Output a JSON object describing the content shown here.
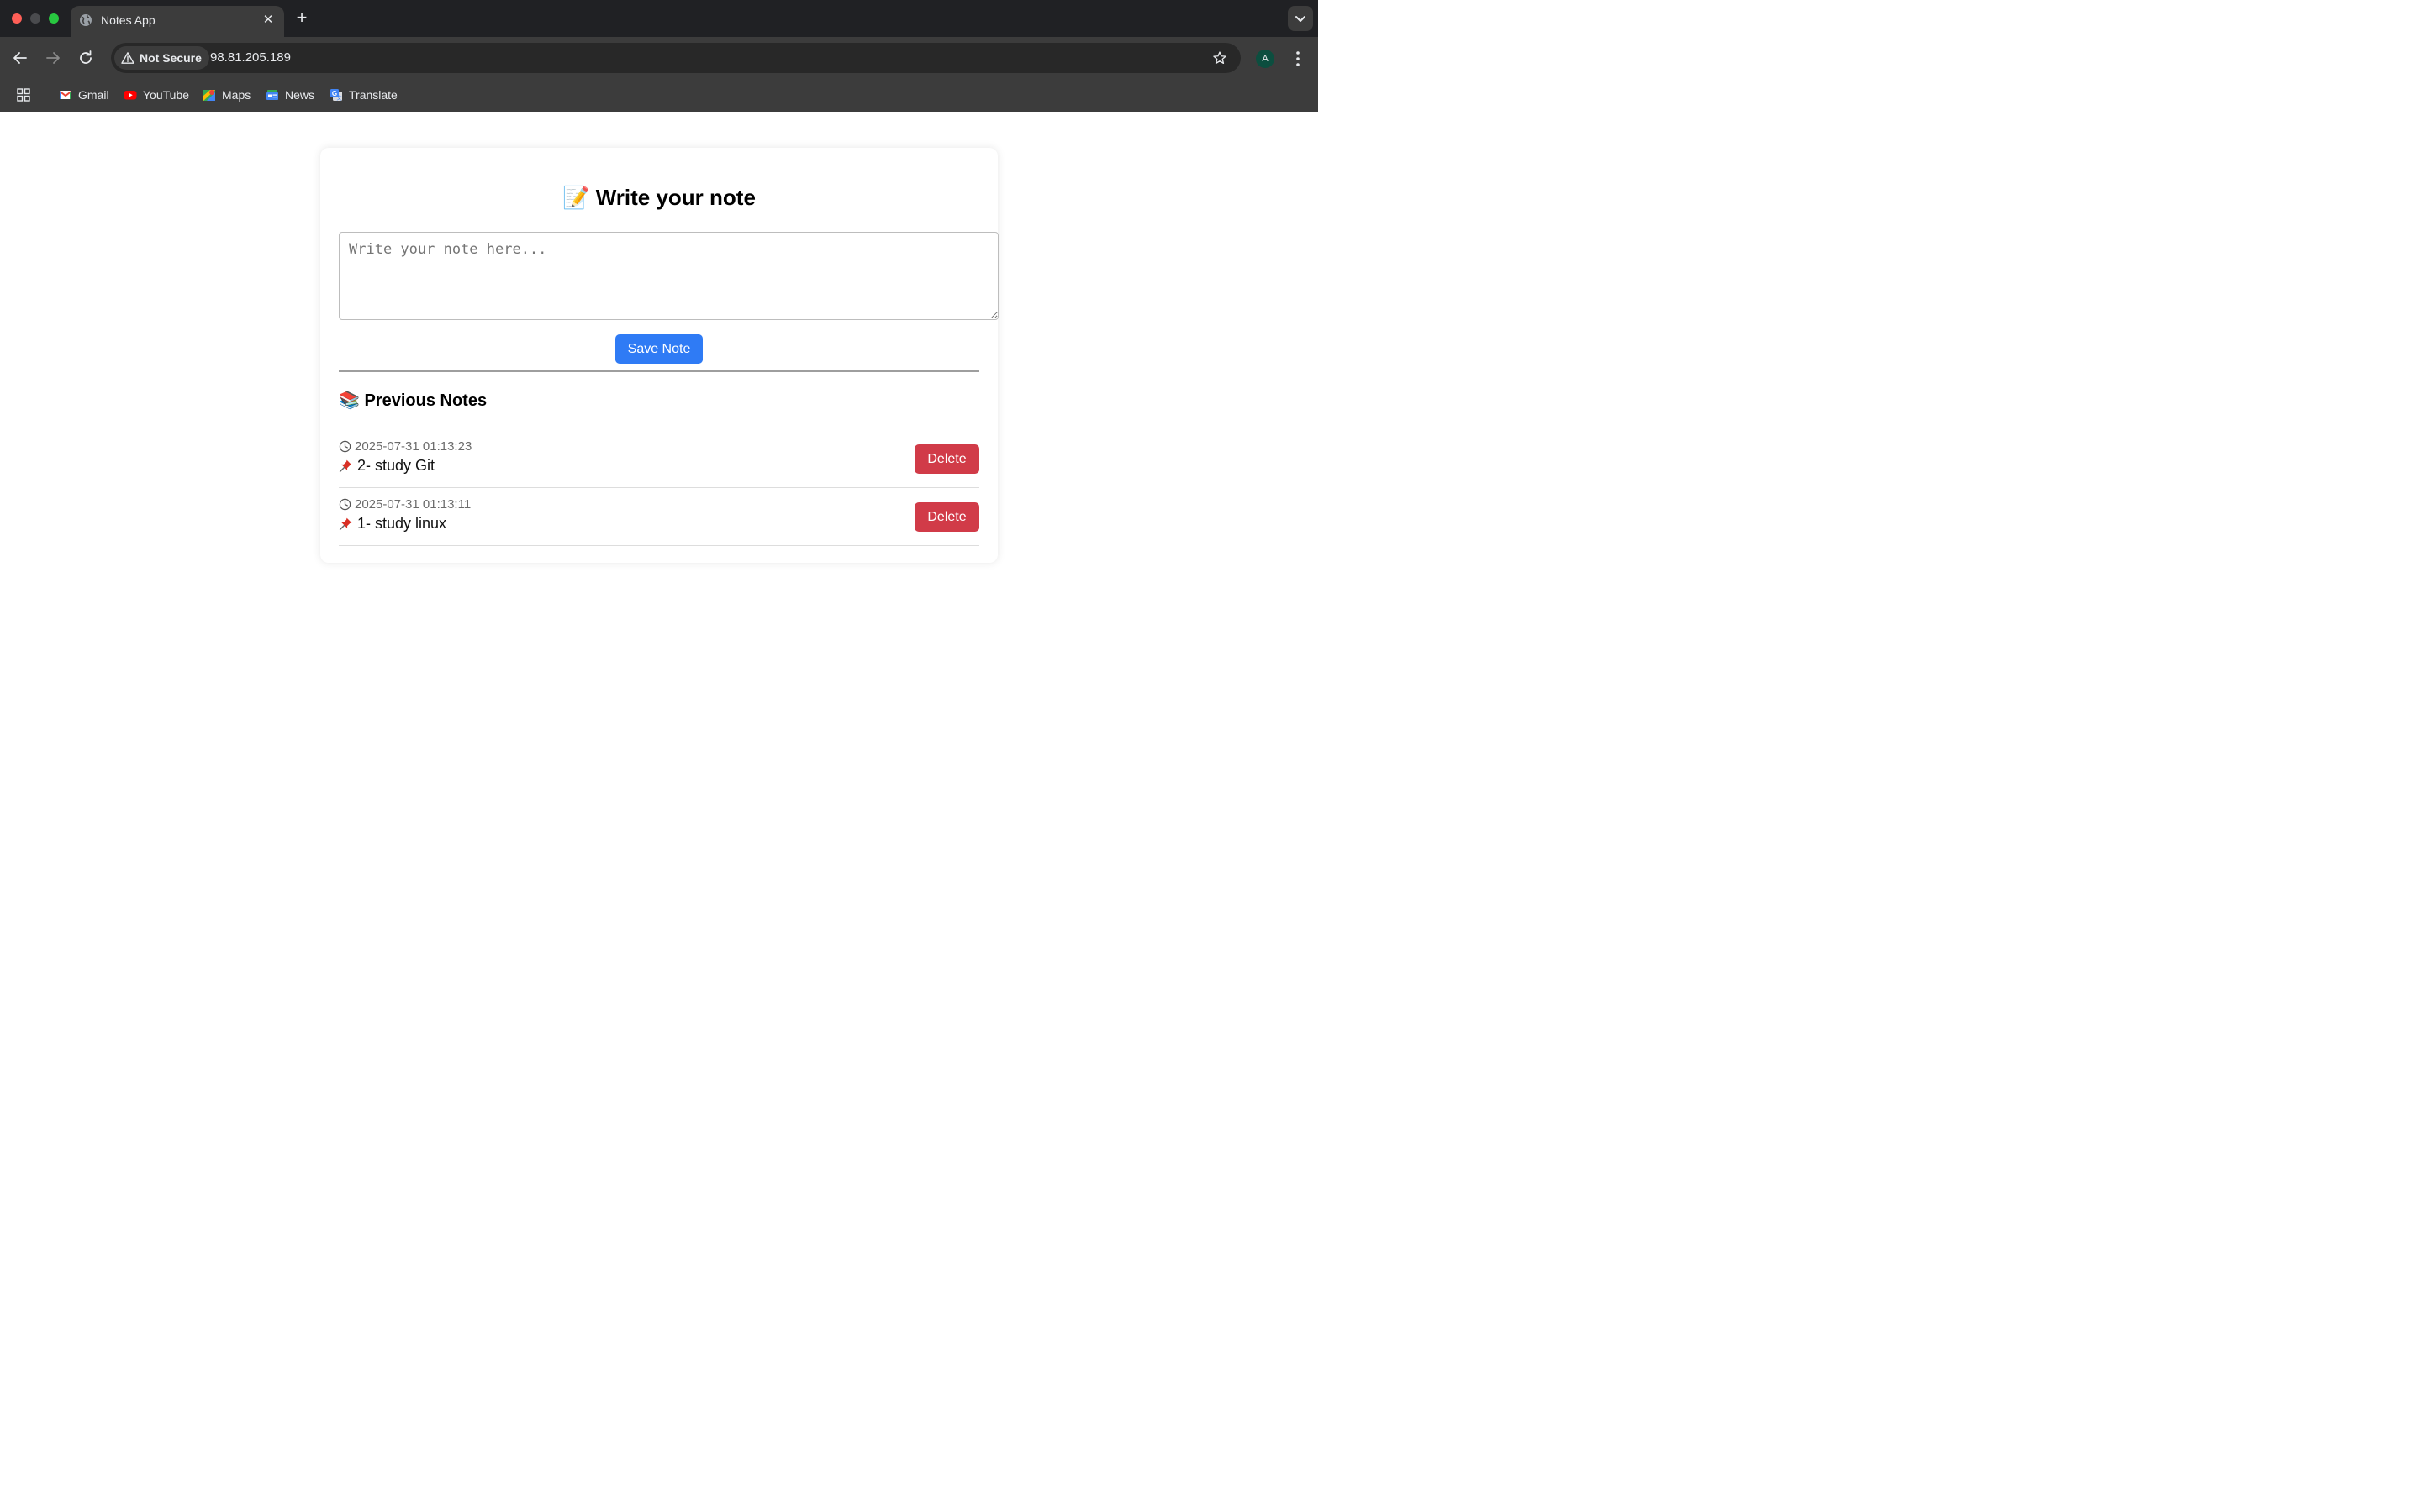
{
  "browser": {
    "tab_title": "Notes App",
    "tab_close": "✕",
    "new_tab": "+",
    "security_label": "Not Secure",
    "url": "98.81.205.189",
    "profile_initial": "A",
    "bookmarks": [
      {
        "label": "Gmail",
        "icon": "gmail-icon"
      },
      {
        "label": "YouTube",
        "icon": "youtube-icon"
      },
      {
        "label": "Maps",
        "icon": "maps-icon"
      },
      {
        "label": "News",
        "icon": "news-icon"
      },
      {
        "label": "Translate",
        "icon": "translate-icon"
      }
    ]
  },
  "page": {
    "title_emoji": "📝",
    "title": "Write your note",
    "input_placeholder": "Write your note here...",
    "save_label": "Save Note",
    "previous_emoji": "📚",
    "previous_title": "Previous Notes",
    "notes": [
      {
        "timestamp": "2025-07-31 01:13:23",
        "text": "2- study Git",
        "delete_label": "Delete"
      },
      {
        "timestamp": "2025-07-31 01:13:11",
        "text": "1- study linux",
        "delete_label": "Delete"
      }
    ]
  },
  "colors": {
    "accent_blue": "#2f7bf5",
    "delete_red": "#d13b48",
    "chrome_dark": "#202124",
    "chrome_toolbar": "#3c3c3c"
  }
}
